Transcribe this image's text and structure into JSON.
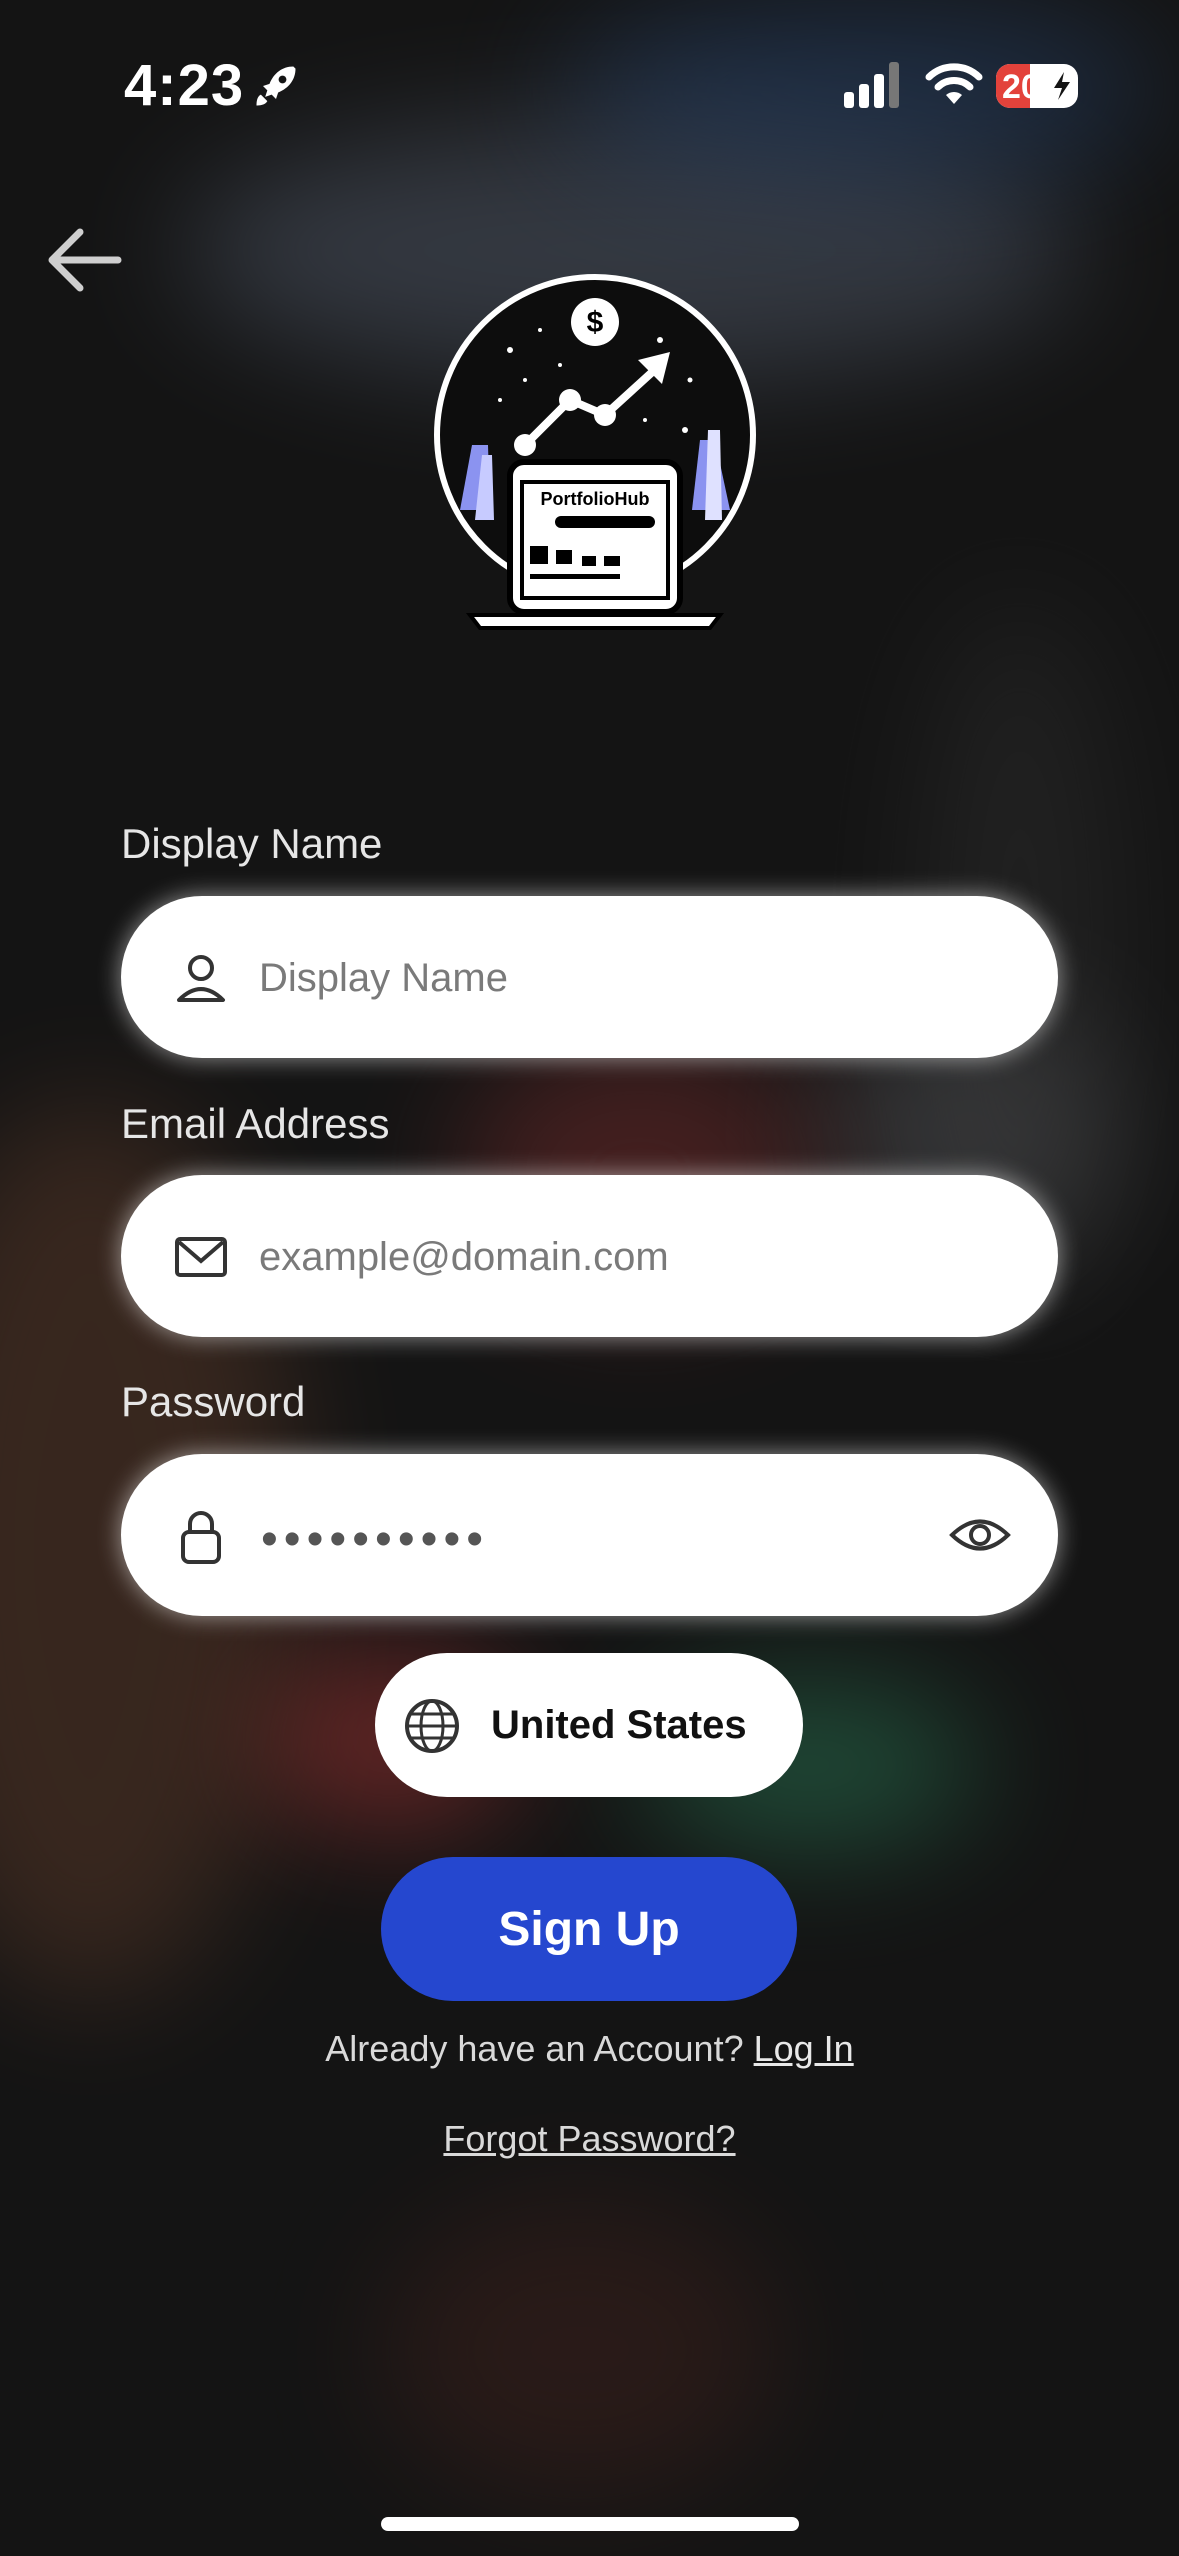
{
  "status_bar": {
    "time": "4:23",
    "battery": "20"
  },
  "logo": {
    "text": "PortfolioHub"
  },
  "form": {
    "display_name": {
      "label": "Display Name",
      "placeholder": "Display Name"
    },
    "email": {
      "label": "Email Address",
      "placeholder": "example@domain.com"
    },
    "password": {
      "label": "Password",
      "value": "••••••••••"
    }
  },
  "country": {
    "value": "United States"
  },
  "signup_button": "Sign Up",
  "login_prompt": {
    "text": "Already have an Account?",
    "link": "Log In"
  },
  "forgot_password": "Forgot Password?",
  "colors": {
    "primary": "#2547cf",
    "battery_low": "#e3423b"
  }
}
